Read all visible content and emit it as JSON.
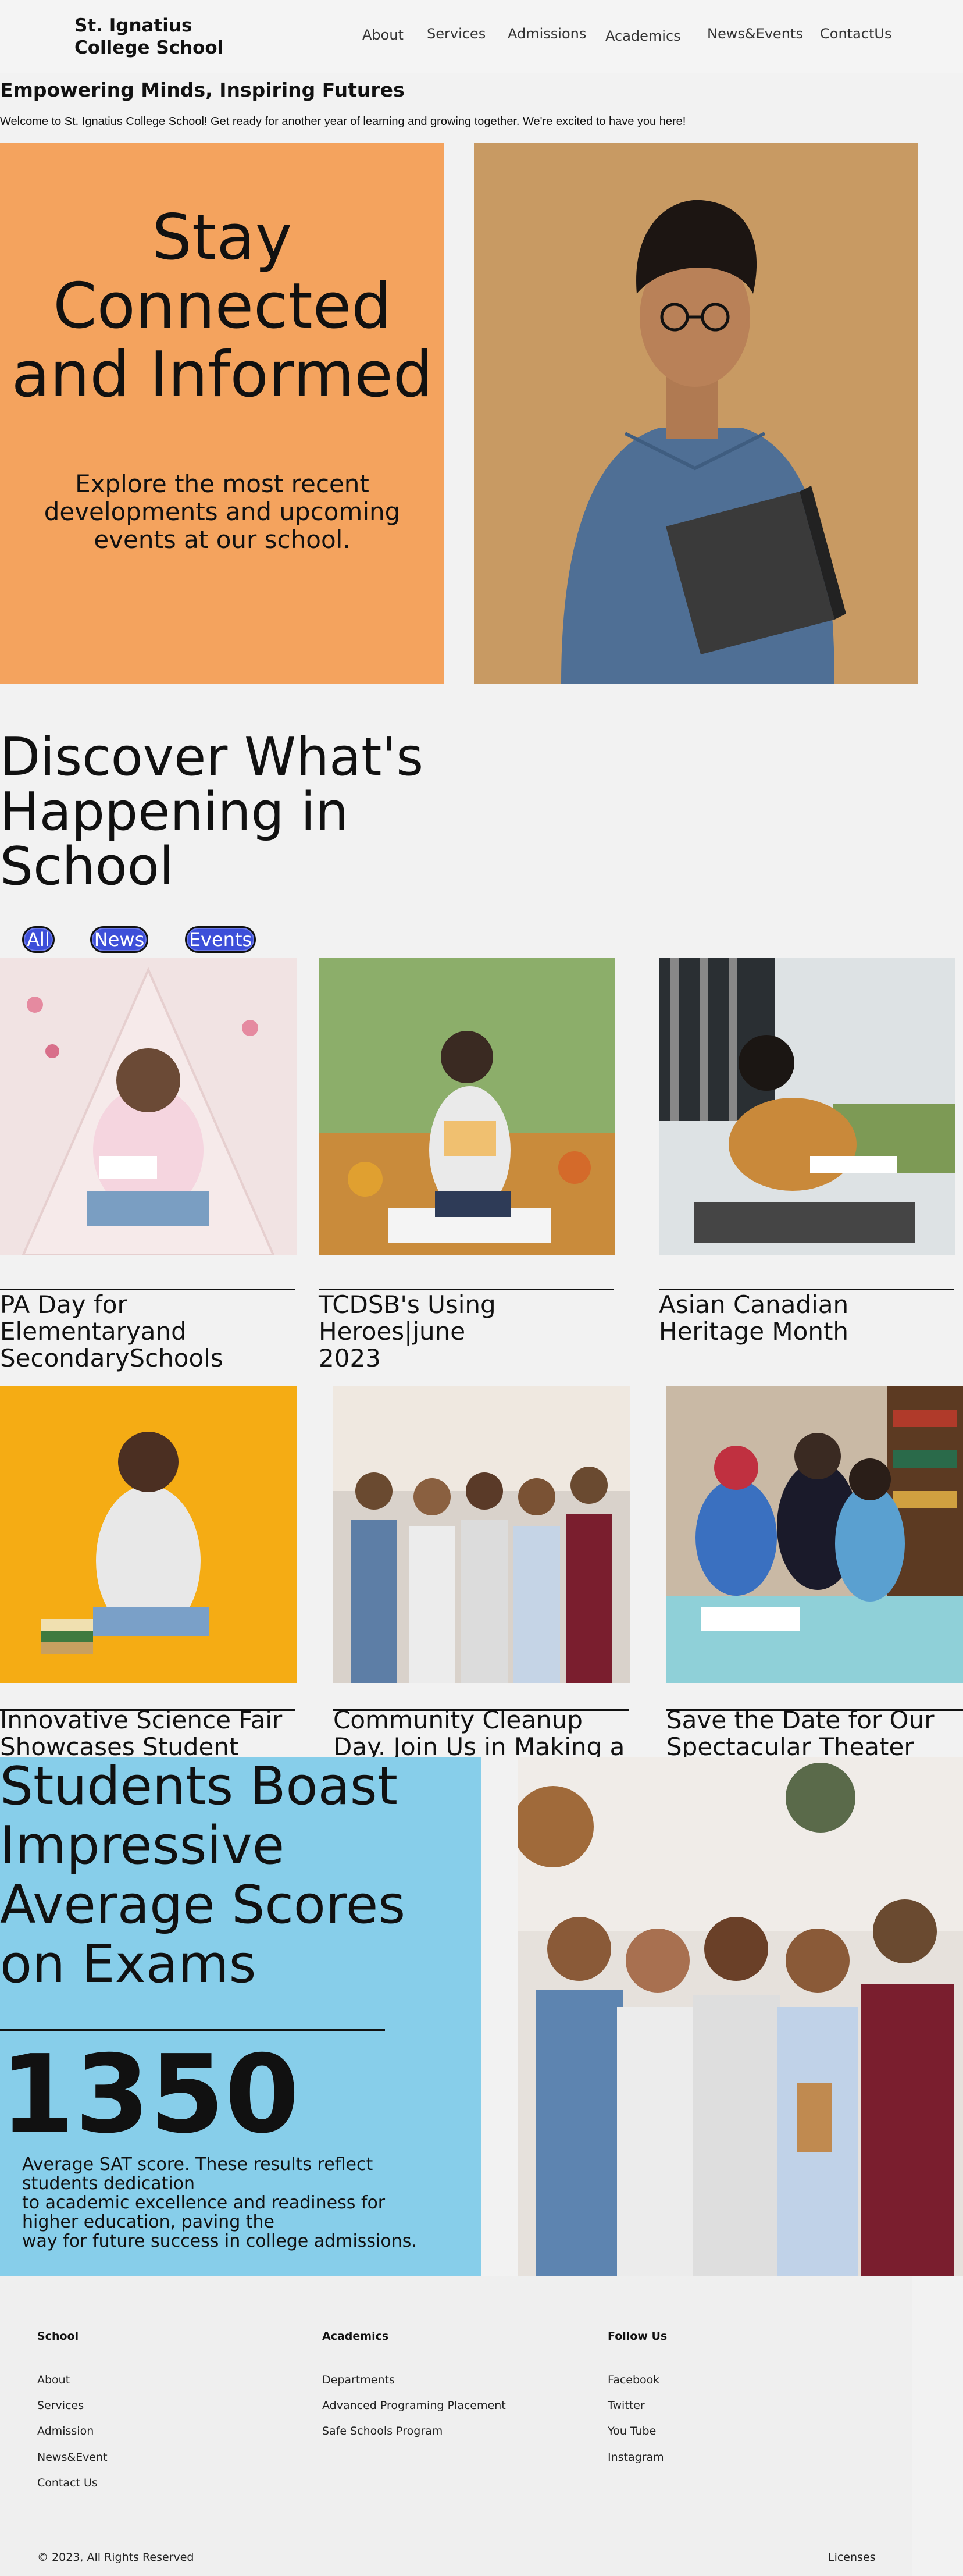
{
  "header": {
    "logo": "St. Ignatius College School",
    "nav": [
      "About",
      "Services",
      "Admissions",
      "Academics",
      "News&Events",
      "ContactUs"
    ]
  },
  "intro": {
    "tagline": "Empowering Minds, Inspiring Futures",
    "welcome": "Welcome to St. Ignatius College School! Get ready for another year of learning and growing together. We're excited to have you here!"
  },
  "hero": {
    "title": "Stay Connected and Informed",
    "subtitle": "Explore the most recent developments and upcoming events at our school."
  },
  "news": {
    "heading": "Discover What's Happening in School",
    "filters": [
      "All",
      "News",
      "Events"
    ],
    "cards": [
      {
        "title": "PA Day for Elementaryand SecondarySchools"
      },
      {
        "title": "TCDSB's Using Heroes|june 2023"
      },
      {
        "title": "Asian Canadian Heritage Month"
      },
      {
        "title": "Innovative Science Fair Showcases Student Talent"
      },
      {
        "title": "Community Cleanup Day. Join Us in Making a Difference"
      },
      {
        "title": "Save the Date for Our Spectacular Theater"
      }
    ]
  },
  "stats": {
    "title": "Students Boast Impressive Average Scores on Exams",
    "number": "1350",
    "description": "Average SAT score. These results reflect\nstudents dedication\nto academic excellence and readiness for\nhigher education, paving the\nway for future success in college admissions."
  },
  "footer": {
    "columns": [
      {
        "heading": "School",
        "links": [
          "About",
          "Services",
          "Admission",
          "News&Event",
          "Contact Us"
        ]
      },
      {
        "heading": "Academics",
        "links": [
          "Departments",
          "Advanced Programing Placement",
          "Safe Schools Program"
        ]
      },
      {
        "heading": "Follow Us",
        "links": [
          "Facebook",
          "Twitter",
          "You Tube",
          "Instagram"
        ]
      }
    ],
    "copyright": "© 2023, All Rights Reserved",
    "licenses": "Licenses"
  },
  "colors": {
    "hero_orange": "#f4a35e",
    "stats_blue": "#87ceea",
    "pill_blue": "#3d4fd9"
  }
}
